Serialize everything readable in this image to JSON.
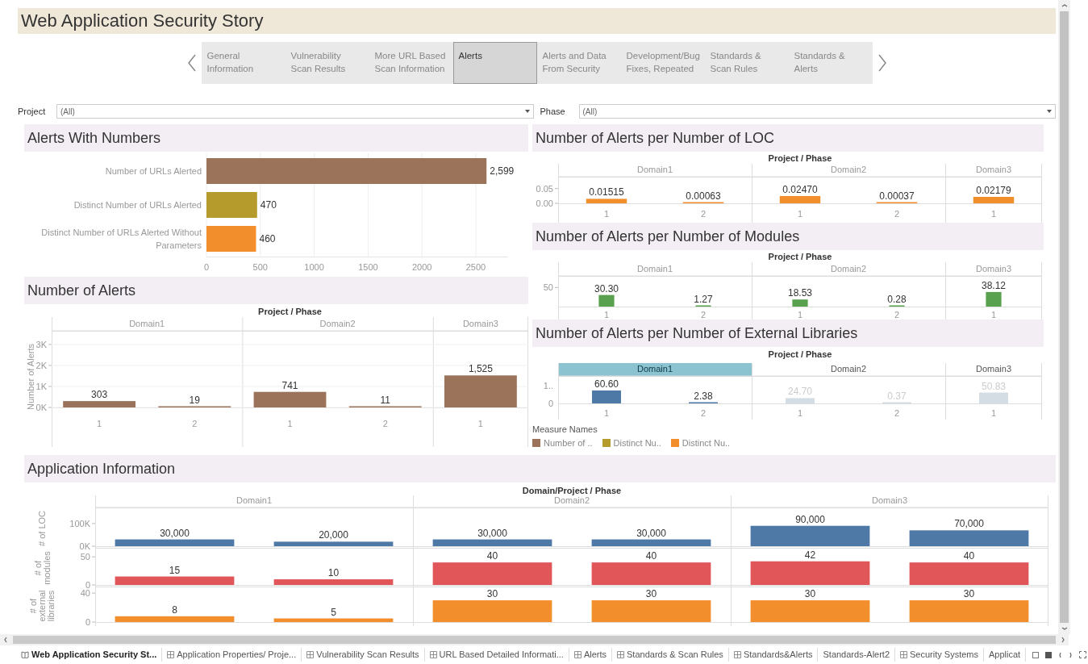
{
  "title": "Web Application Security Story",
  "story_nav": {
    "points": [
      {
        "label": "General Information",
        "selected": false
      },
      {
        "label": "Vulnerability Scan Results",
        "selected": false
      },
      {
        "label": "More URL Based Scan Information",
        "selected": false
      },
      {
        "label": "Alerts",
        "selected": true
      },
      {
        "label": "Alerts and Data From Security",
        "selected": false
      },
      {
        "label": "Development/Bug Fixes, Repeated",
        "selected": false
      },
      {
        "label": "Standards & Scan Rules",
        "selected": false
      },
      {
        "label": "Standards & Alerts",
        "selected": false
      }
    ]
  },
  "filters": [
    {
      "label": "Project",
      "value": "(All)"
    },
    {
      "label": "Phase",
      "value": "(All)"
    }
  ],
  "alerts_with_numbers": {
    "title": "Alerts With Numbers",
    "chart_data": {
      "type": "bar",
      "orientation": "horizontal",
      "grid": true,
      "xlim": [
        0,
        2800
      ],
      "categories": [
        "Number of URLs Alerted",
        "Distinct Number of URLs Alerted",
        "Distinct Number of URLs Alerted Without Parameters"
      ],
      "values": [
        2599,
        470,
        460
      ],
      "value_labels": [
        "2,599",
        "470",
        "460"
      ],
      "xticks": [
        0,
        500,
        1000,
        1500,
        2000,
        2500
      ]
    }
  },
  "number_of_alerts": {
    "title": "Number of Alerts",
    "facet_title": "Project / Phase",
    "domains": [
      {
        "label": "Domain1",
        "phases": [
          "1",
          "2"
        ]
      },
      {
        "label": "Domain2",
        "phases": [
          "1",
          "2"
        ]
      },
      {
        "label": "Domain3",
        "phases": [
          "1"
        ]
      }
    ],
    "chart_data": {
      "type": "bar",
      "grid": true,
      "ylabel": "Number of Alerts",
      "values": [
        303,
        19,
        741,
        11,
        1525
      ],
      "value_labels": [
        "303",
        "19",
        "741",
        "11",
        "1,525"
      ],
      "yticks": [
        {
          "value": 0,
          "label": "0K"
        },
        {
          "value": 1000,
          "label": "1K"
        },
        {
          "value": 2000,
          "label": "2K"
        },
        {
          "value": 3000,
          "label": "3K"
        }
      ],
      "ylim": [
        0,
        3650
      ]
    },
    "color": "#9b735a"
  },
  "alerts_per_loc": {
    "title": "Number of Alerts per Number of LOC",
    "facet_title": "Project / Phase",
    "domains": [
      {
        "label": "Domain1",
        "phases": [
          "1",
          "2"
        ]
      },
      {
        "label": "Domain2",
        "phases": [
          "1",
          "2"
        ]
      },
      {
        "label": "Domain3",
        "phases": [
          "1"
        ]
      }
    ],
    "chart_data": {
      "type": "bar",
      "values": [
        0.01515,
        0.00063,
        0.0247,
        0.00037,
        0.02179
      ],
      "value_labels": [
        "0.01515",
        "0.00063",
        "0.02470",
        "0.00037",
        "0.02179"
      ],
      "yticks": [
        {
          "value": 0,
          "label": "0.00"
        },
        {
          "value": 0.05,
          "label": "0.05"
        }
      ],
      "ylim": [
        0,
        0.09
      ]
    },
    "color": "#f28e2b"
  },
  "alerts_per_modules": {
    "title": "Number of Alerts per Number of Modules",
    "facet_title": "Project / Phase",
    "domains": [
      {
        "label": "Domain1",
        "phases": [
          "1",
          "2"
        ]
      },
      {
        "label": "Domain2",
        "phases": [
          "1",
          "2"
        ]
      },
      {
        "label": "Domain3",
        "phases": [
          "1"
        ]
      }
    ],
    "chart_data": {
      "type": "bar",
      "values": [
        30.3,
        1.27,
        18.53,
        0.28,
        38.12
      ],
      "value_labels": [
        "30.30",
        "1.27",
        "18.53",
        "0.28",
        "38.12"
      ],
      "yticks": [
        {
          "value": 50,
          "label": "50"
        }
      ],
      "ylim": [
        0,
        80
      ]
    },
    "color": "#59a14f"
  },
  "alerts_per_libraries": {
    "title": "Number of Alerts per Number of External Libraries",
    "facet_title": "Project / Phase",
    "domains": [
      {
        "label": "Domain1",
        "phases": [
          "1",
          "2"
        ],
        "selected": true
      },
      {
        "label": "Domain2",
        "phases": [
          "1",
          "2"
        ],
        "selected": false
      },
      {
        "label": "Domain3",
        "phases": [
          "1"
        ],
        "selected": false
      }
    ],
    "axis_labels": [
      "1..",
      "0"
    ],
    "chart_data": {
      "type": "bar",
      "values": [
        60.6,
        2.38,
        24.7,
        0.37,
        50.83
      ],
      "value_labels": [
        "60.60",
        "2.38",
        "24.70",
        "0.37",
        "50.83"
      ]
    },
    "color": "#4e79a7"
  },
  "legend": {
    "title": "Measure Names",
    "items": [
      {
        "label": "Number of ..",
        "color": "#9b735a"
      },
      {
        "label": "Distinct Nu..",
        "color": "#b59b2c"
      },
      {
        "label": "Distinct Nu..",
        "color": "#f28e2b"
      }
    ]
  },
  "application_information": {
    "title": "Application Information",
    "facet_title": "Domain/Project / Phase",
    "domains": [
      {
        "label": "Domain1"
      },
      {
        "label": "Domain2"
      },
      {
        "label": "Domain3"
      }
    ],
    "rows": [
      {
        "color": "#4e79a7",
        "chart_data": {
          "type": "bar",
          "ylabel": "# of LOC",
          "values": [
            30000,
            20000,
            30000,
            30000,
            90000,
            70000
          ],
          "value_labels": [
            "30,000",
            "20,000",
            "30,000",
            "30,000",
            "90,000",
            "70,000"
          ],
          "yticks": [
            {
              "value": 0,
              "label": "0K"
            },
            {
              "value": 100000,
              "label": "100K"
            }
          ],
          "ylim": [
            0,
            171000
          ]
        }
      },
      {
        "color": "#e15759",
        "chart_data": {
          "type": "bar",
          "ylabel": "# of modules",
          "values": [
            15,
            10,
            40,
            40,
            42,
            40
          ],
          "value_labels": [
            "15",
            "10",
            "40",
            "40",
            "42",
            "40"
          ],
          "yticks": [
            {
              "value": 0,
              "label": "0"
            },
            {
              "value": 50,
              "label": "50"
            }
          ],
          "ylim": [
            0,
            66
          ]
        }
      },
      {
        "color": "#f28e2b",
        "chart_data": {
          "type": "bar",
          "ylabel": "# of external libraries",
          "values": [
            8,
            5,
            30,
            30,
            30,
            30
          ],
          "value_labels": [
            "8",
            "5",
            "30",
            "30",
            "30",
            "30"
          ],
          "yticks": [
            {
              "value": 0,
              "label": "0"
            },
            {
              "value": 40,
              "label": "40"
            }
          ],
          "ylim": [
            0,
            49
          ]
        }
      }
    ]
  },
  "sheet_tabs": [
    {
      "label": "Web Application Security St...",
      "kind": "story",
      "selected": true
    },
    {
      "label": "Application Properties/ Proje...",
      "kind": "dashboard",
      "selected": false
    },
    {
      "label": "Vulnerability Scan Results",
      "kind": "dashboard",
      "selected": false
    },
    {
      "label": "URL Based Detailed Informati...",
      "kind": "dashboard",
      "selected": false
    },
    {
      "label": "Alerts",
      "kind": "dashboard",
      "selected": false
    },
    {
      "label": "Standards & Scan Rules",
      "kind": "dashboard",
      "selected": false
    },
    {
      "label": "Standards&Alerts",
      "kind": "dashboard",
      "selected": false
    },
    {
      "label": "Standards-Alert2",
      "kind": "sheet",
      "selected": false
    },
    {
      "label": "Security Systems",
      "kind": "dashboard",
      "selected": false
    },
    {
      "label": "Applicat",
      "kind": "sheet",
      "selected": false
    }
  ]
}
